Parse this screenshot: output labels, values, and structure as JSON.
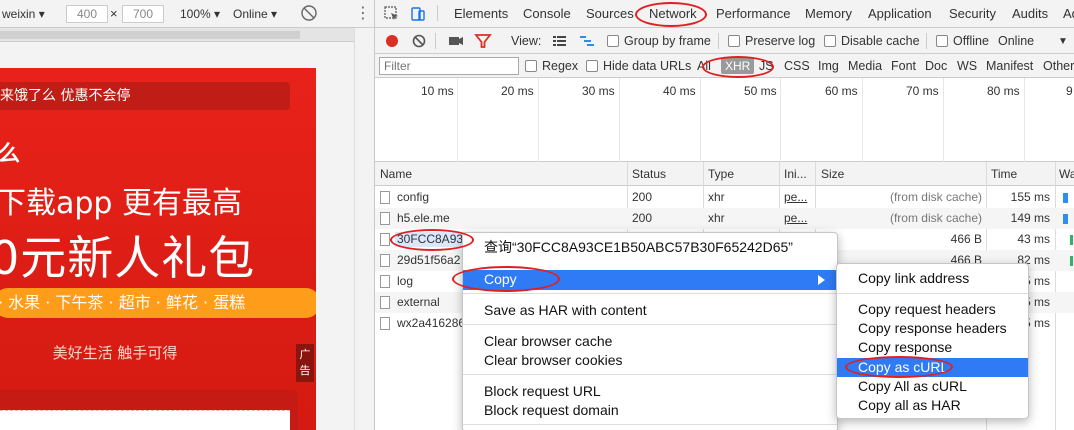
{
  "device_bar": {
    "device": "weixin",
    "width": "400",
    "times": "×",
    "height": "700",
    "zoom": "100%",
    "network": "Online"
  },
  "page": {
    "promo": "来饿了么 优惠不会停",
    "logo": "么",
    "headline1": "下载app  更有最高",
    "headline2": "0元新人礼包",
    "categories": "· 水果 · 下午茶 · 超市 · 鲜花 · 蛋糕",
    "slogan": "美好生活 触手可得",
    "ad": "广告"
  },
  "devtools": {
    "tabs": [
      "Elements",
      "Console",
      "Sources",
      "Network",
      "Performance",
      "Memory",
      "Application",
      "Security",
      "Audits",
      "Ad"
    ],
    "active_tab": "Network",
    "toolbar": {
      "view_label": "View:",
      "group_by_frame": "Group by frame",
      "preserve_log": "Preserve log",
      "disable_cache": "Disable cache",
      "offline": "Offline",
      "throttle": "Online"
    },
    "filter": {
      "placeholder": "Filter",
      "regex": "Regex",
      "hide_data_urls": "Hide data URLs",
      "types": [
        "All",
        "XHR",
        "JS",
        "CSS",
        "Img",
        "Media",
        "Font",
        "Doc",
        "WS",
        "Manifest",
        "Other"
      ],
      "active_type": "XHR"
    },
    "timeline_ticks": [
      "10 ms",
      "20 ms",
      "30 ms",
      "40 ms",
      "50 ms",
      "60 ms",
      "70 ms",
      "80 ms",
      "9"
    ],
    "columns": [
      "Name",
      "Status",
      "Type",
      "Ini...",
      "Size",
      "Time",
      "Wa"
    ],
    "rows": [
      {
        "name": "config",
        "status": "200",
        "type": "xhr",
        "initiator": "pe...",
        "size": "(from disk cache)",
        "time": "155 ms"
      },
      {
        "name": "h5.ele.me",
        "status": "200",
        "type": "xhr",
        "initiator": "pe...",
        "size": "(from disk cache)",
        "time": "149 ms"
      },
      {
        "name": "30FCC8A93",
        "status": "",
        "type": "",
        "initiator": "",
        "size": "466 B",
        "time": "43 ms"
      },
      {
        "name": "29d51f56a2",
        "status": "",
        "type": "",
        "initiator": "",
        "size": "466 B",
        "time": "82 ms"
      },
      {
        "name": "log",
        "status": "",
        "type": "",
        "initiator": "",
        "size": "",
        "time": "5 ms"
      },
      {
        "name": "external",
        "status": "",
        "type": "",
        "initiator": "",
        "size": "",
        "time": "5 ms"
      },
      {
        "name": "wx2a416286",
        "status": "",
        "type": "",
        "initiator": "",
        "size": "",
        "time": "5 ms"
      }
    ]
  },
  "context_menu": {
    "items": [
      "查询“30FCC8A93CE1B50ABC57B30F65242D65”",
      "Copy",
      "Save as HAR with content",
      "Clear browser cache",
      "Clear browser cookies",
      "Block request URL",
      "Block request domain"
    ],
    "highlighted": "Copy"
  },
  "submenu": {
    "items": [
      "Copy link address",
      "Copy request headers",
      "Copy response headers",
      "Copy response",
      "Copy as cURL",
      "Copy All as cURL",
      "Copy all as HAR"
    ],
    "highlighted": "Copy as cURL"
  },
  "colors": {
    "accent": "#2f7bf5",
    "annotation": "#e02020",
    "record": "#d93025",
    "promo_red": "#e8221a",
    "category_orange": "#ff9c1a"
  }
}
